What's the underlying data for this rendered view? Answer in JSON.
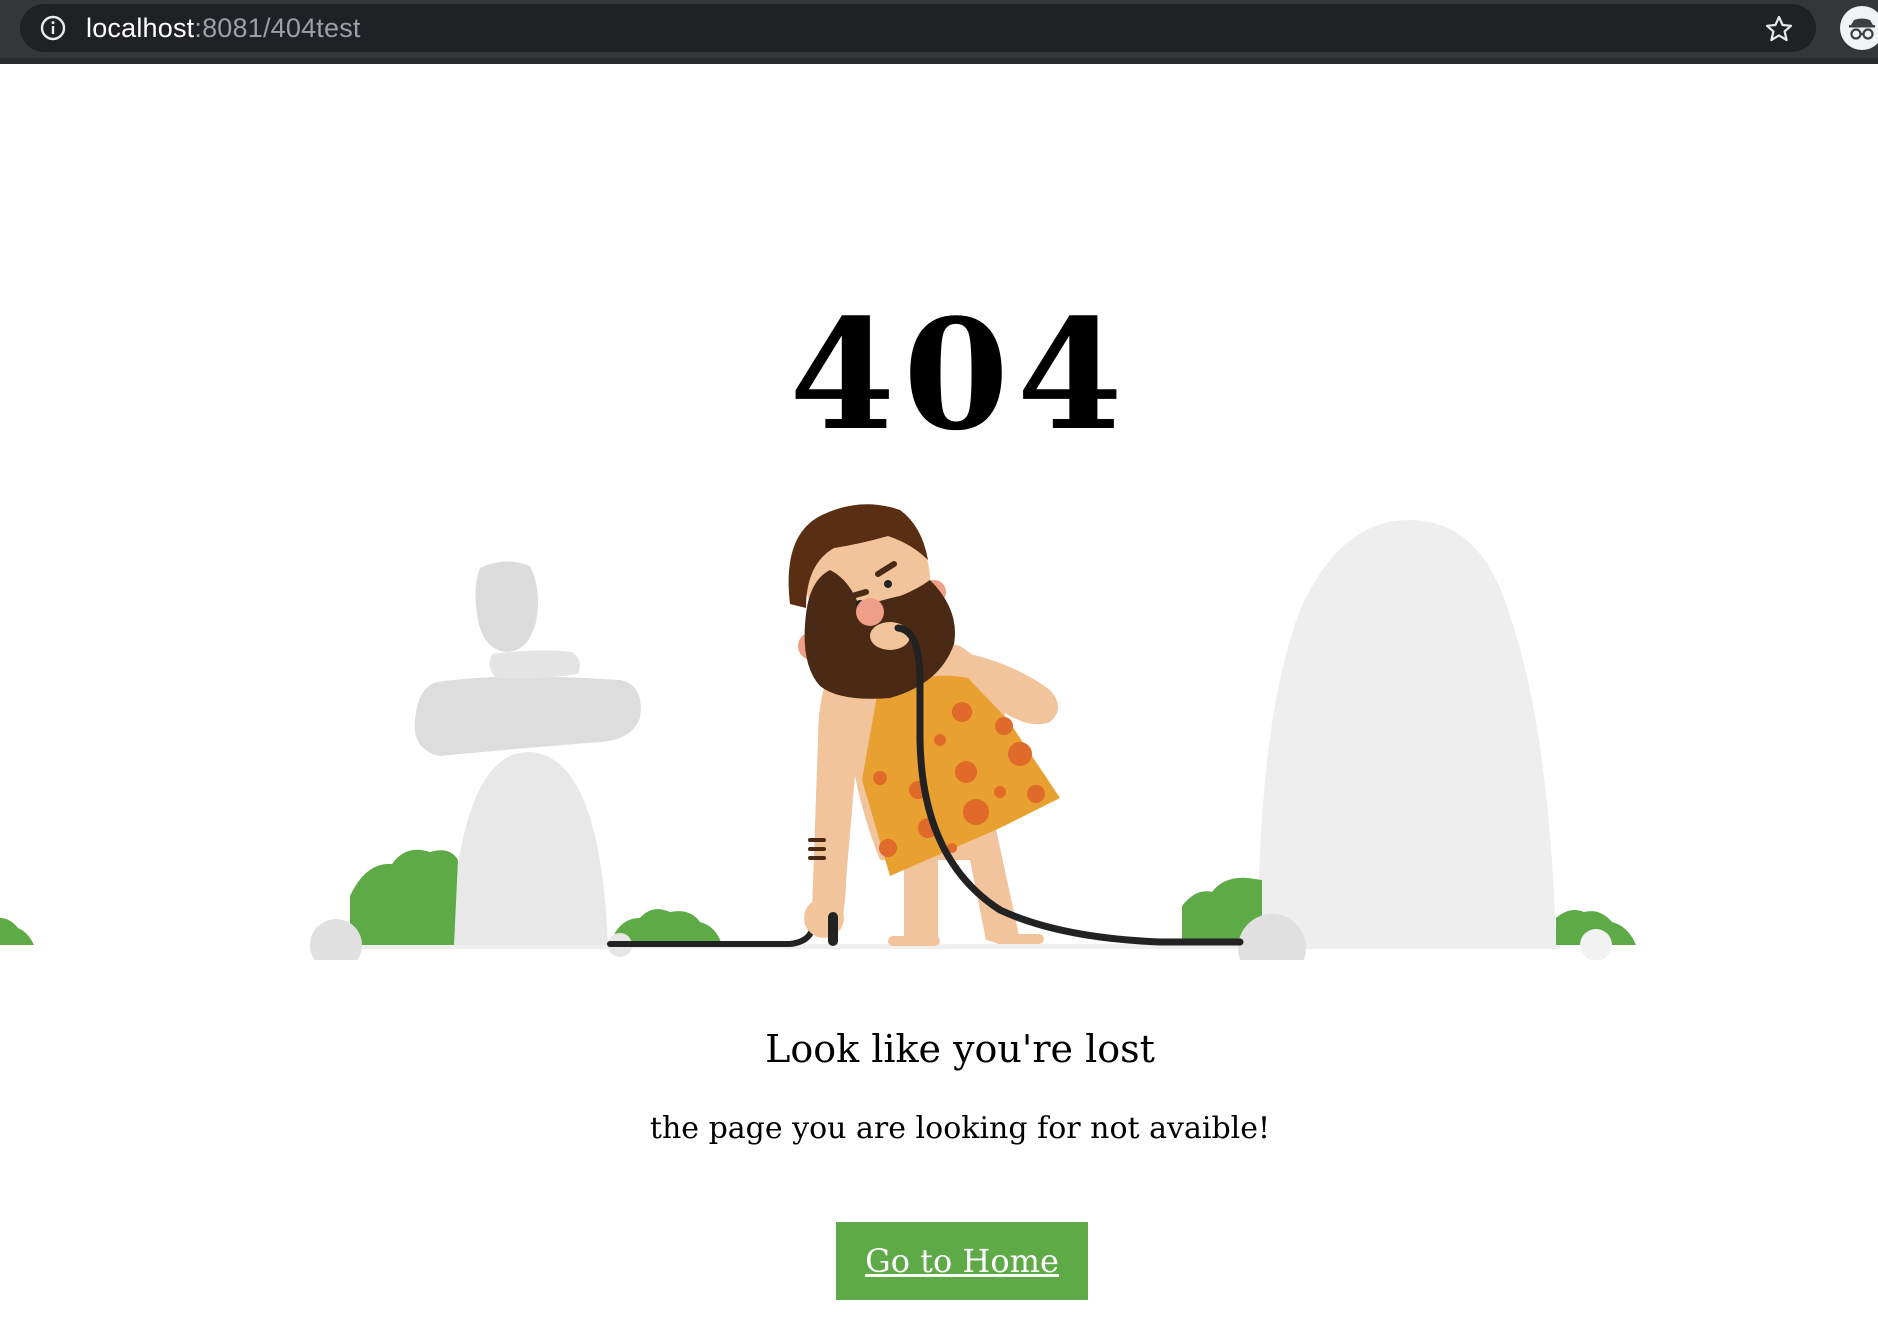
{
  "browser": {
    "url_host": "localhost",
    "url_rest": ":8081/404test"
  },
  "page": {
    "code": "404",
    "heading": "Look like you're lost",
    "subtext": "the page you are looking for not avaible!",
    "button_label": "Go to Home"
  },
  "colors": {
    "accent_green": "#5eaa47",
    "rock": "#e6e6e6",
    "tunic": "#e8a030"
  },
  "icons": {
    "info": "info-icon",
    "star": "star-icon",
    "incognito": "incognito-icon"
  }
}
